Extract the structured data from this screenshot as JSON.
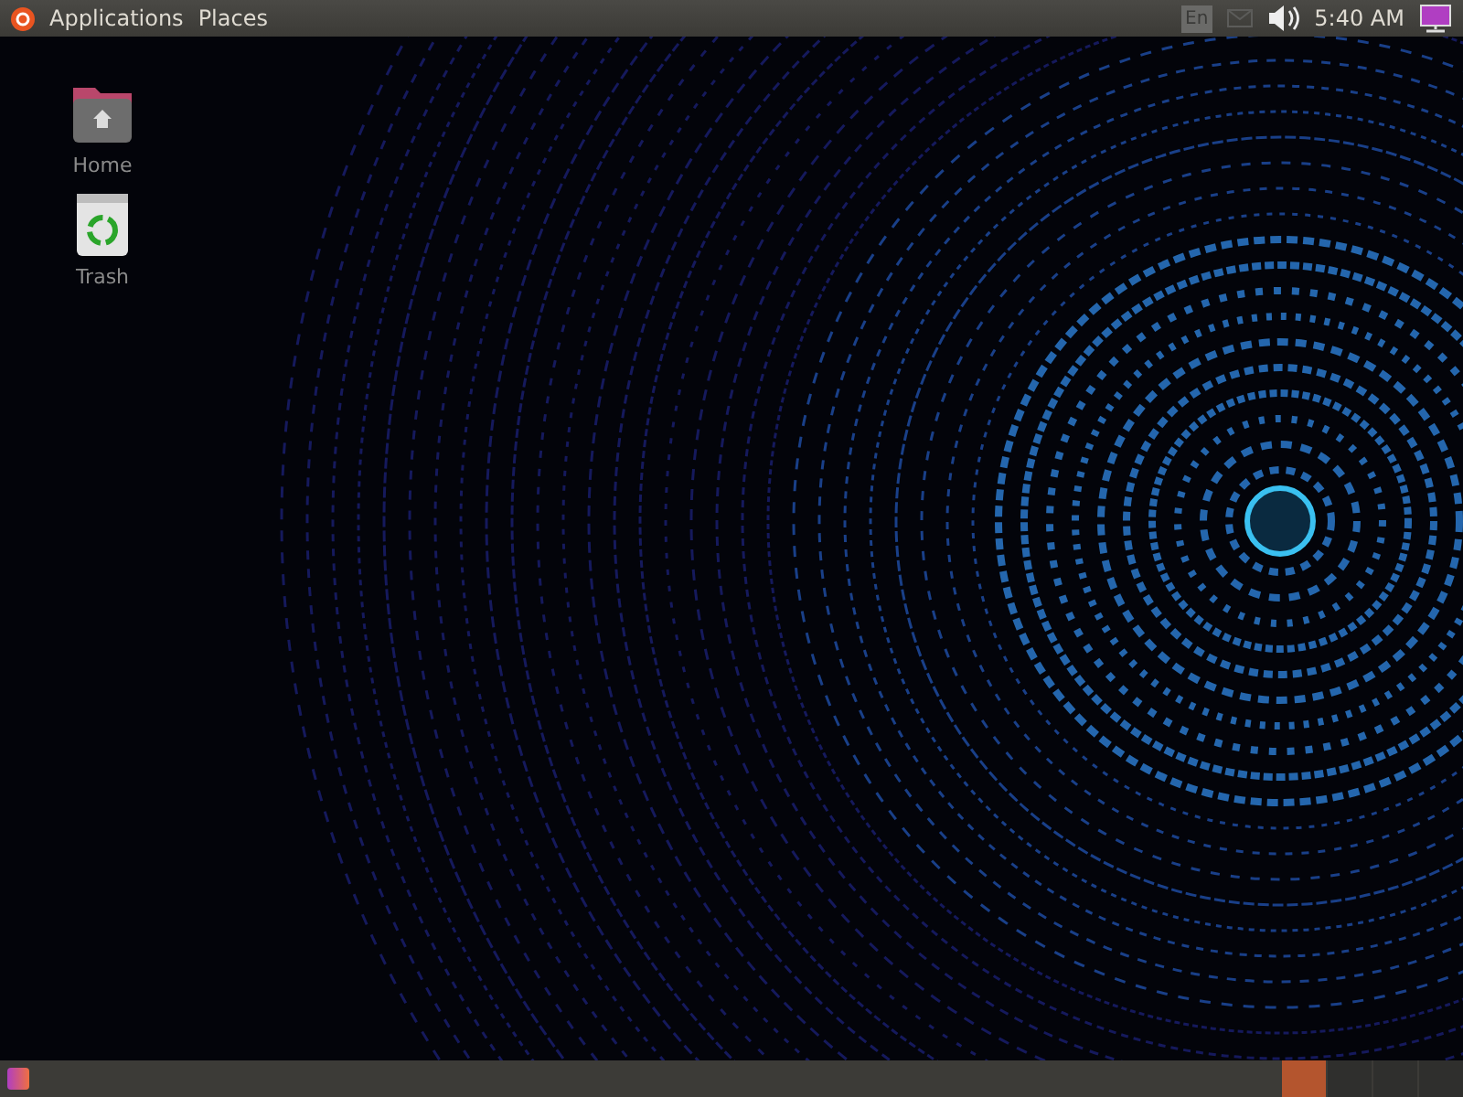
{
  "top_panel": {
    "menus": [
      "Applications",
      "Places"
    ],
    "keyboard_layout": "En",
    "clock": "5:40 AM"
  },
  "desktop_icons": [
    {
      "label": "Home",
      "kind": "folder"
    },
    {
      "label": "Trash",
      "kind": "trash"
    }
  ],
  "bottom_panel": {
    "workspaces": [
      {
        "selected": true
      },
      {
        "selected": false
      },
      {
        "selected": false
      },
      {
        "selected": false
      }
    ]
  }
}
